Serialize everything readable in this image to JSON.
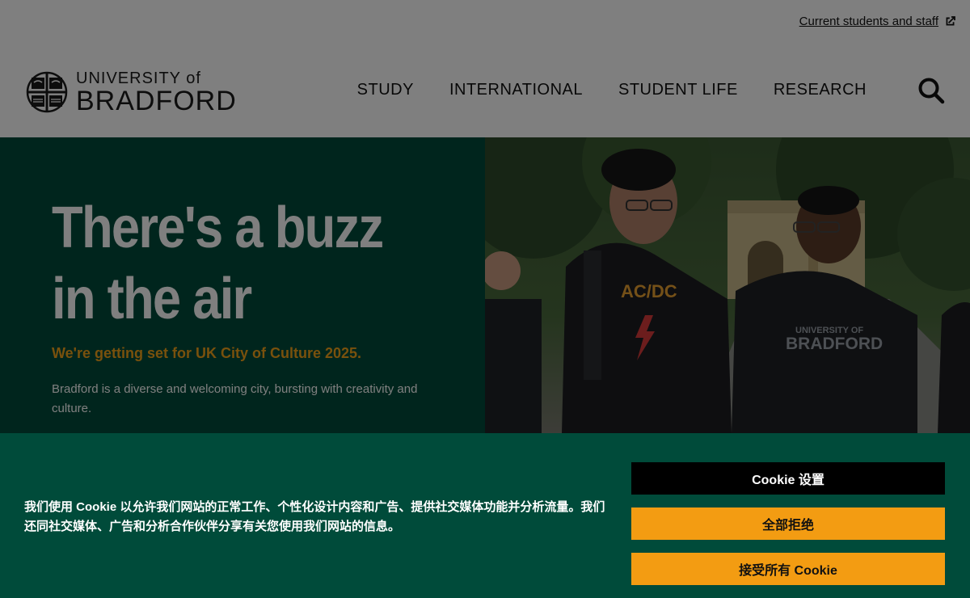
{
  "header": {
    "utility_link": "Current students and staff",
    "logo": {
      "line1": "UNIVERSITY of",
      "line2": "BRADFORD"
    },
    "nav": [
      {
        "label": "STUDY"
      },
      {
        "label": "INTERNATIONAL"
      },
      {
        "label": "STUDENT LIFE"
      },
      {
        "label": "RESEARCH"
      }
    ]
  },
  "hero": {
    "heading_line1": "There's a buzz",
    "heading_line2": "in the air",
    "subheading": "We're getting set for UK City of Culture 2025.",
    "body": "Bradford is a diverse and welcoming city, bursting with creativity and culture.",
    "photo": {
      "hoodie_left": "AC/DC",
      "hoodie_right_line1": "UNIVERSITY OF",
      "hoodie_right_line2": "BRADFORD"
    }
  },
  "cookie_banner": {
    "text": "我们使用 Cookie 以允许我们网站的正常工作、个性化设计内容和广告、提供社交媒体功能并分析流量。我们还同社交媒体、广告和分析合作伙伴分享有关您使用我们网站的信息。",
    "settings_label": "Cookie 设置",
    "reject_label": "全部拒绝",
    "accept_label": "接受所有 Cookie"
  },
  "colors": {
    "brand_green": "#004b3a",
    "accent_orange": "#f39c12",
    "overlay": "rgba(0,0,0,0.5)"
  },
  "icons": {
    "external": "external-link-icon",
    "search": "search-icon"
  }
}
